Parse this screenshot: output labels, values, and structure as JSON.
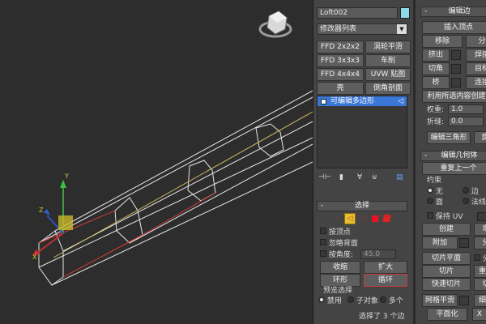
{
  "object_name": "Loft002",
  "object_color": "#8fd9ea",
  "modifier_list": "修改器列表",
  "modifier_buttons": [
    [
      "FFD 2x2x2",
      "涡轮平滑"
    ],
    [
      "FFD 3x3x3",
      "车削"
    ],
    [
      "FFD 4x4x4",
      "UVW 贴图"
    ],
    [
      "壳",
      "倒角剖面"
    ]
  ],
  "stack_item": "可编辑多边形",
  "selection": {
    "title": "选择",
    "sign": "-",
    "by_vertex": "按顶点",
    "ignore_backfacing": "忽略背面",
    "by_angle": "按角度:",
    "angle_value": "45.0",
    "shrink": "收缩",
    "grow": "扩大",
    "ring": "环形",
    "loop": "循环",
    "preview_title": "预览选择",
    "preview_options": [
      "禁用",
      "子对象",
      "多个"
    ],
    "status": "选择了 3 个边"
  },
  "edit_edges": {
    "title": "编辑边",
    "insert_vertex": "插入顶点",
    "remove": "移除",
    "split": "分",
    "extrude": "挤出",
    "weld": "焊接",
    "chamfer": "切角",
    "target_weld": "目标",
    "bridge": "桥",
    "connect": "连接",
    "create_shape": "利用所选内容创建图",
    "weight_label": "权重:",
    "weight_value": "1.0",
    "crease_label": "折缝:",
    "crease_value": "0.0",
    "edit_tri": "编辑三角形",
    "rotate": "旋"
  },
  "edit_geometry": {
    "title": "编辑几何体",
    "repeat_last": "重复上一个",
    "constraints": "约束",
    "constraint_options": [
      "无",
      "边",
      "面",
      "法线"
    ],
    "preserve_uv": "保持 UV",
    "create": "创建",
    "collapse": "塌",
    "attach": "附加",
    "detach": "分",
    "slice_plane": "切片平面",
    "split": "分割",
    "slice": "切片",
    "reset_plane": "重置",
    "quickslice": "快速切片",
    "cut": "切",
    "meshsmooth": "网格平滑",
    "tessellate": "细化",
    "planarize": "平面化",
    "x": "X"
  }
}
